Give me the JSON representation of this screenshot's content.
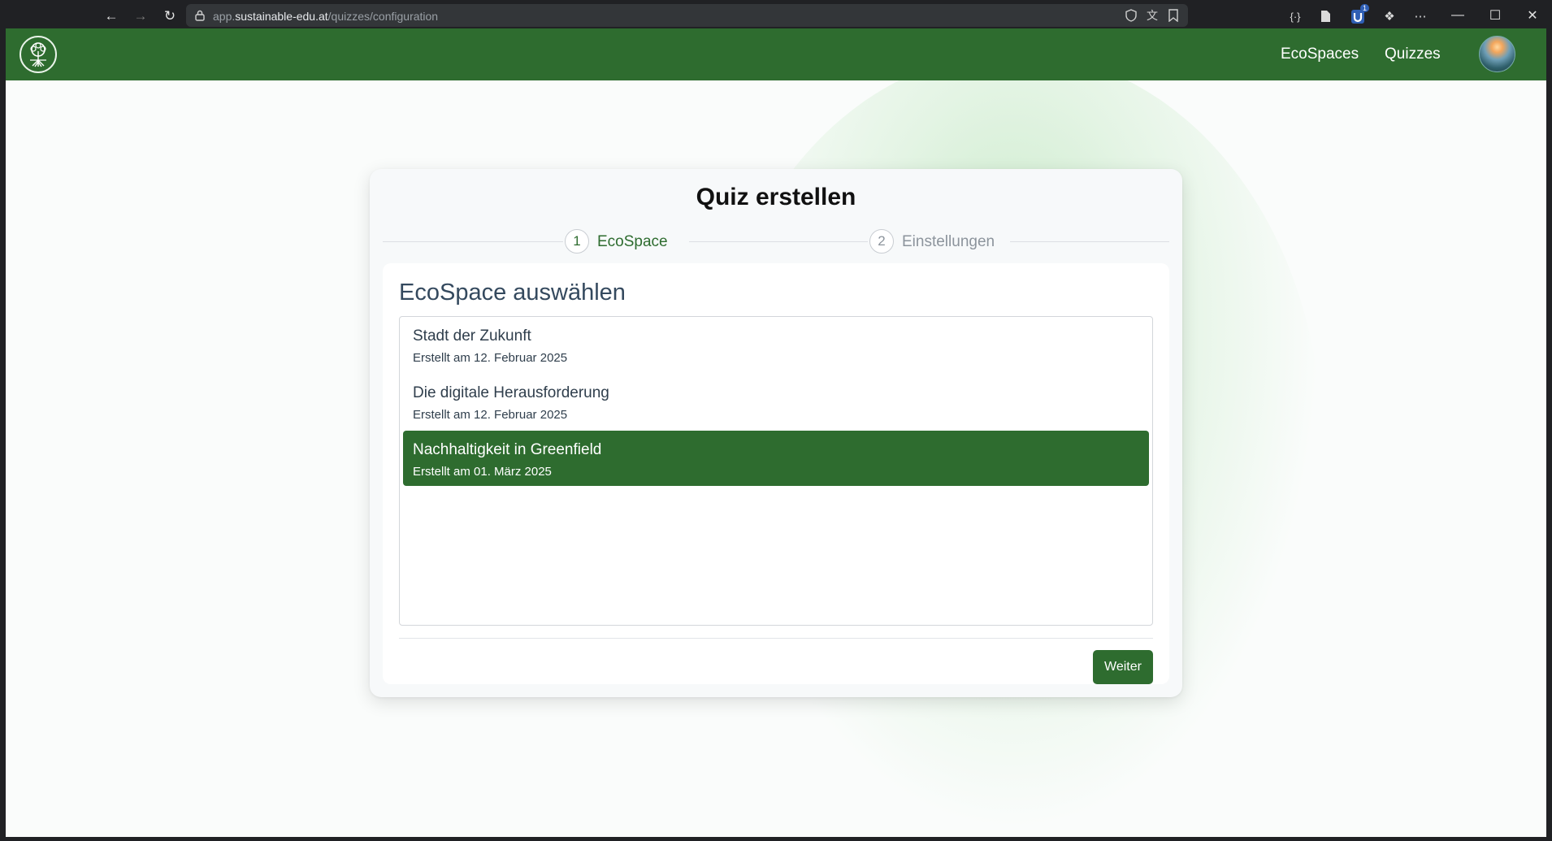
{
  "browser": {
    "url_prefix": "app.",
    "url_domain": "sustainable-edu.at",
    "url_path": "/quizzes/configuration",
    "icons": [
      "back-arrow-icon",
      "forward-arrow-icon",
      "reload-icon",
      "lock-icon",
      "shield-icon",
      "translate-icon",
      "reading-list-icon",
      "braces-icon",
      "document-icon",
      "extension-badge-icon",
      "puzzle-icon",
      "more-icon"
    ],
    "extension_badge": "1"
  },
  "app": {
    "logo_icon": "tree-logo-icon",
    "nav": [
      "EcoSpaces",
      "Quizzes"
    ],
    "accent_color": "#2e6c2f"
  },
  "card": {
    "title": "Quiz erstellen",
    "steps": [
      {
        "number": "1",
        "label": "EcoSpace",
        "active": true
      },
      {
        "number": "2",
        "label": "Einstellungen",
        "active": false
      }
    ],
    "section_title": "EcoSpace auswählen",
    "items": [
      {
        "name": "Stadt der Zukunft",
        "date": "Erstellt am 12. Februar 2025",
        "selected": false
      },
      {
        "name": "Die digitale Herausforderung",
        "date": "Erstellt am 12. Februar 2025",
        "selected": false
      },
      {
        "name": "Nachhaltigkeit in Greenfield",
        "date": "Erstellt am 01. März 2025",
        "selected": true
      }
    ],
    "next_button": "Weiter"
  }
}
